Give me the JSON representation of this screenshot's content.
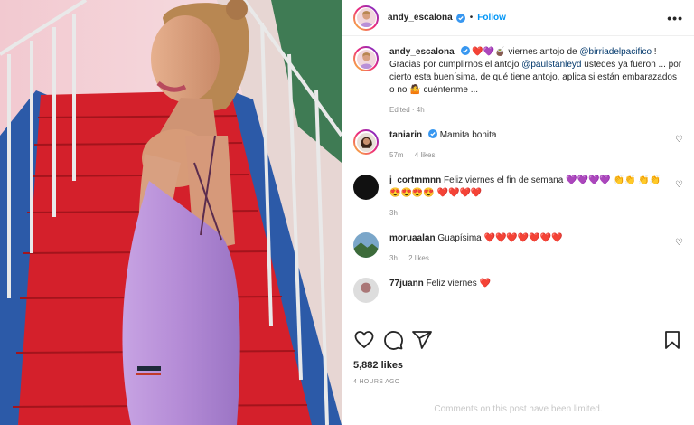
{
  "post": {
    "username": "andy_escalona",
    "follow_label": "Follow",
    "more_label": "•••",
    "likes": "5,882 likes",
    "time_ago": "4 HOURS AGO",
    "limited_notice": "Comments on this post have been limited."
  },
  "caption": {
    "username": "andy_escalona",
    "emoji_lead": " ❤️💜🧉 ",
    "text_1": "viernes antojo de ",
    "mention_1": "@birriadelpacifico",
    "text_2": " ! Gracias por cumplirnos el antojo ",
    "mention_2": "@paulstanleyd",
    "text_3": " ustedes ya fueron ... por cierto esta buenísima, de qué tiene antojo, aplica si están embarazados o no 🤷 cuéntenme ...",
    "meta": "Edited · 4h"
  },
  "comments": [
    {
      "username": "taniarin",
      "text": "Mamita bonita",
      "time": "57m",
      "likes": "4 likes"
    },
    {
      "username": "j_cortmmnn",
      "text": "Feliz viernes el fin de semana 💜💜💜💜 👏👏 👏👏 😍😍😍😍 ❤️❤️❤️❤️",
      "time": "3h",
      "likes": ""
    },
    {
      "username": "moruaalan",
      "text": "Guapísima ❤️❤️❤️❤️❤️❤️❤️",
      "time": "3h",
      "likes": "2 likes"
    },
    {
      "username": "77juann",
      "text": "Feliz viernes ❤️",
      "time": "",
      "likes": ""
    }
  ],
  "icons": {
    "verified": "verified-badge-icon",
    "like": "heart-icon",
    "comment": "comment-icon",
    "share": "share-icon",
    "save": "bookmark-icon"
  },
  "colors": {
    "accent": "#0095f6",
    "verified": "#3897f0",
    "mention": "#00376b",
    "muted": "#8e8e8e",
    "carpet": "#d4202b",
    "dress": "#b98fd8"
  }
}
